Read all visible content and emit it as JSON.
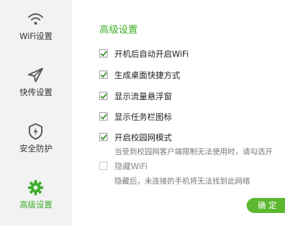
{
  "sidebar": {
    "items": [
      {
        "label": "WiFi设置",
        "icon": "wifi-icon"
      },
      {
        "label": "快传设置",
        "icon": "send-icon"
      },
      {
        "label": "安全防护",
        "icon": "shield-icon"
      },
      {
        "label": "高级设置",
        "icon": "gear-icon",
        "active": true
      }
    ]
  },
  "main": {
    "title": "高级设置",
    "options": [
      {
        "label": "开机后自动开启WiFi",
        "checked": true
      },
      {
        "label": "生成桌面快捷方式",
        "checked": true
      },
      {
        "label": "显示流量悬浮窗",
        "checked": true
      },
      {
        "label": "显示任务栏图标",
        "checked": true
      },
      {
        "label": "开启校园网模式",
        "checked": true
      },
      {
        "label": "隐藏WiFi",
        "checked": false,
        "disabled": true
      }
    ],
    "campus_desc": "当受到校园网客户端限制无法使用时，请勾选开",
    "hide_desc": "隐藏后，未连接的手机将无法找到此网络",
    "confirm_label": "确 定"
  },
  "colors": {
    "accent": "#3fae2a",
    "button": "#5cb831",
    "sidebar_bg": "#f2f2f2"
  }
}
